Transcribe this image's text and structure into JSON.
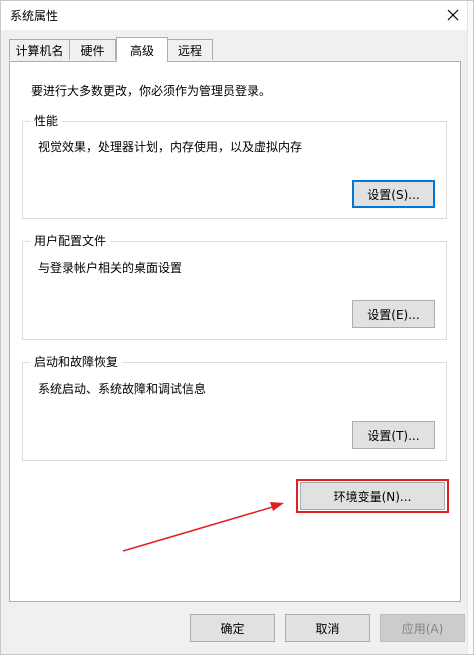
{
  "window": {
    "title": "系统属性",
    "close_glyph": "✕"
  },
  "tabs": [
    {
      "label": "计算机名"
    },
    {
      "label": "硬件"
    },
    {
      "label": "高级",
      "active": true
    },
    {
      "label": "远程"
    }
  ],
  "advanced": {
    "admin_note": "要进行大多数更改，你必须作为管理员登录。",
    "performance": {
      "title": "性能",
      "description": "视觉效果，处理器计划，内存使用，以及虚拟内存",
      "button": "设置(S)..."
    },
    "user_profiles": {
      "title": "用户配置文件",
      "description": "与登录帐户相关的桌面设置",
      "button": "设置(E)..."
    },
    "startup_recovery": {
      "title": "启动和故障恢复",
      "description": "系统启动、系统故障和调试信息",
      "button": "设置(T)..."
    },
    "env_vars_button": "环境变量(N)..."
  },
  "footer": {
    "ok": "确定",
    "cancel": "取消",
    "apply": "应用(A)"
  },
  "annotation": {
    "color": "#e02020"
  }
}
